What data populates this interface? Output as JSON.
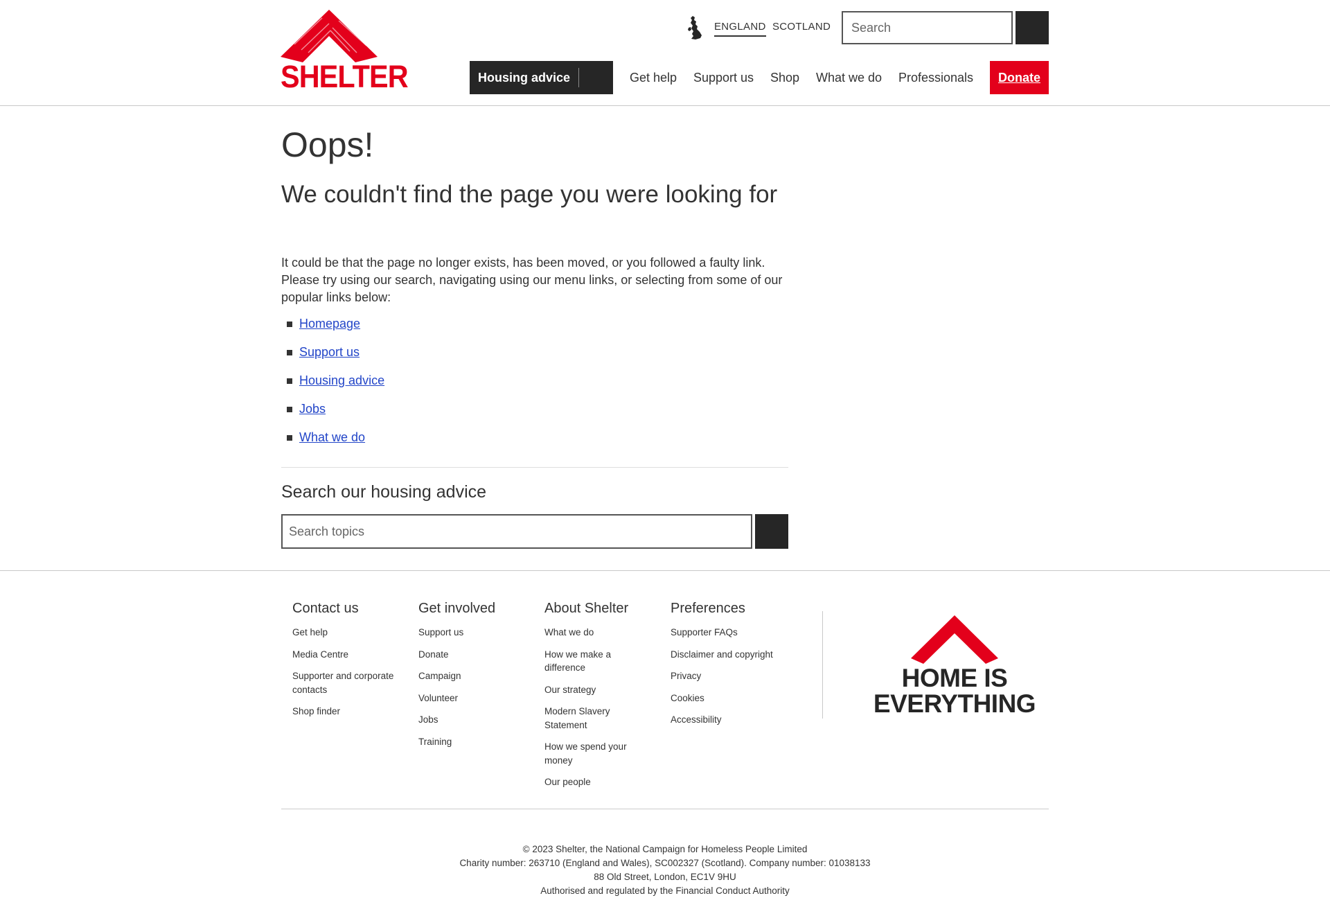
{
  "header": {
    "logo_text": "SHELTER",
    "regions": [
      "ENGLAND",
      "SCOTLAND"
    ],
    "search_placeholder": "Search",
    "housing_advice_label": "Housing advice",
    "nav": [
      "Get help",
      "Support us",
      "Shop",
      "What we do",
      "Professionals"
    ],
    "donate_label": "Donate"
  },
  "main": {
    "title": "Oops!",
    "subtitle": "We couldn't find the page you were looking for",
    "intro": "It could be that the page no longer exists, has been moved, or you followed a faulty link. Please try using our search, navigating using our menu links, or selecting from some of our popular links below:",
    "popular_links": [
      "Homepage",
      "Support us",
      "Housing advice",
      "Jobs",
      "What we do"
    ],
    "search_heading": "Search our housing advice",
    "search_placeholder": "Search topics"
  },
  "footer": {
    "columns": [
      {
        "heading": "Contact us",
        "links": [
          "Get help",
          "Media Centre",
          "Supporter and corporate contacts",
          "Shop finder"
        ]
      },
      {
        "heading": "Get involved",
        "links": [
          "Support us",
          "Donate",
          "Campaign",
          "Volunteer",
          "Jobs",
          "Training"
        ]
      },
      {
        "heading": "About Shelter",
        "links": [
          "What we do",
          "How we make a difference",
          "Our strategy",
          "Modern Slavery Statement",
          "How we spend your money",
          "Our people"
        ]
      },
      {
        "heading": "Preferences",
        "links": [
          "Supporter FAQs",
          "Disclaimer and copyright",
          "Privacy",
          "Cookies",
          "Accessibility"
        ]
      }
    ],
    "tagline_line1": "HOME IS",
    "tagline_line2": "EVERYTHING",
    "legal": [
      "© 2023 Shelter, the National Campaign for Homeless People Limited",
      "Charity number: 263710 (England and Wales), SC002327 (Scotland). Company number: 01038133",
      "88 Old Street, London, EC1V 9HU",
      "Authorised and regulated by the Financial Conduct Authority"
    ]
  },
  "colors": {
    "brand_red": "#e3001b",
    "dark": "#262626",
    "link_blue": "#2245c8"
  }
}
